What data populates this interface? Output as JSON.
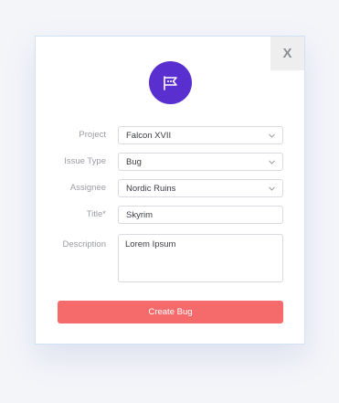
{
  "dialog": {
    "close_label": "X",
    "icon": "flag-icon",
    "fields": {
      "project": {
        "label": "Project",
        "value": "Falcon XVII"
      },
      "issue_type": {
        "label": "Issue Type",
        "value": "Bug"
      },
      "assignee": {
        "label": "Assignee",
        "value": "Nordic Ruins"
      },
      "title": {
        "label": "Title*",
        "value": "Skyrim"
      },
      "description": {
        "label": "Description",
        "value": "Lorem Ipsum"
      }
    },
    "submit_label": "Create Bug"
  },
  "colors": {
    "accent": "#5a2fcf",
    "button": "#f56b6c"
  }
}
